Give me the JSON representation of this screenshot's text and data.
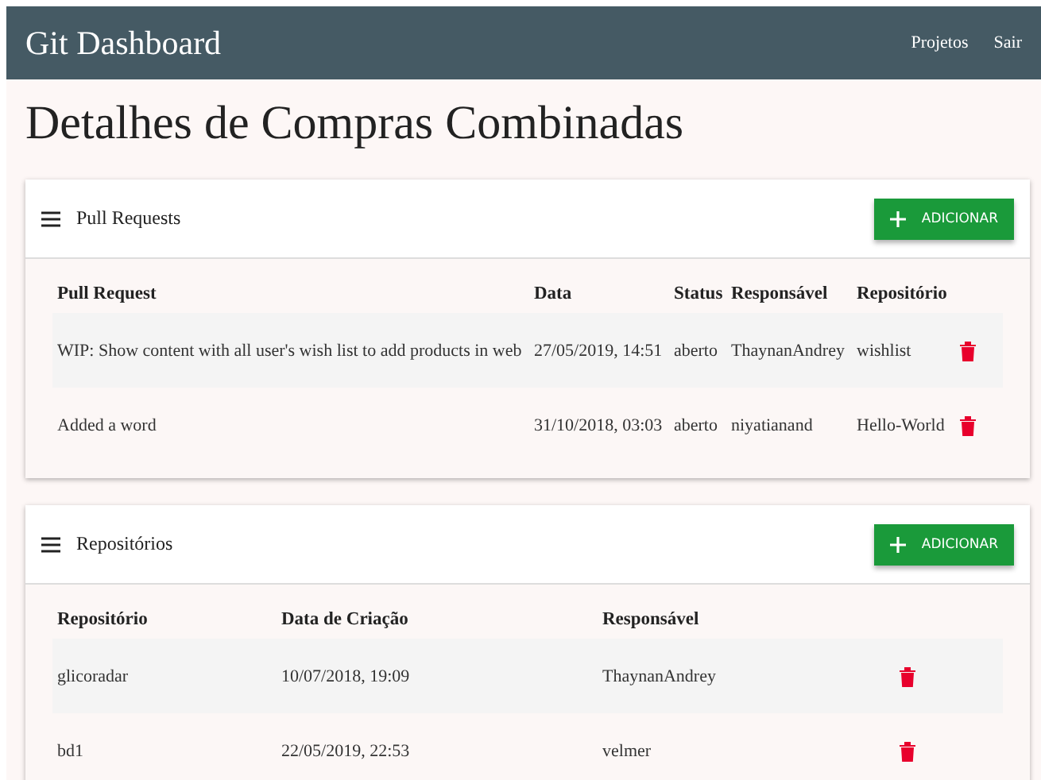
{
  "navbar": {
    "title": "Git Dashboard",
    "links": [
      "Projetos",
      "Sair"
    ]
  },
  "page_title": "Detalhes de Compras Combinadas",
  "cards": [
    {
      "title": "Pull Requests",
      "button": "ADICIONAR",
      "columns": [
        "Pull Request",
        "Data",
        "Status",
        "Responsável",
        "Repositório"
      ],
      "rows": [
        {
          "cells": [
            "WIP: Show content with all user's wish list to add products in web",
            "27/05/2019, 14:51",
            "aberto",
            "ThaynanAndrey",
            "wishlist"
          ]
        },
        {
          "cells": [
            "Added a word",
            "31/10/2018, 03:03",
            "aberto",
            "niyatianand",
            "Hello-World"
          ]
        }
      ]
    },
    {
      "title": "Repositórios",
      "button": "ADICIONAR",
      "columns": [
        "Repositório",
        "Data de Criação",
        "Responsável"
      ],
      "rows": [
        {
          "cells": [
            "glicoradar",
            "10/07/2018, 19:09",
            "ThaynanAndrey"
          ]
        },
        {
          "cells": [
            "bd1",
            "22/05/2019, 22:53",
            "velmer"
          ]
        }
      ]
    }
  ]
}
